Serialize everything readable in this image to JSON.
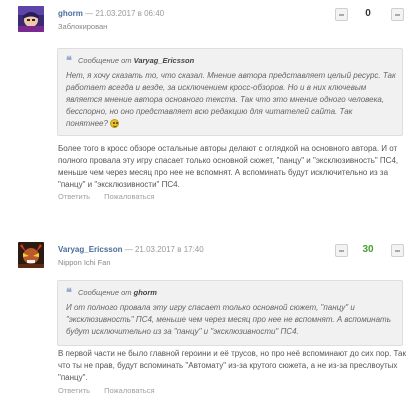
{
  "comments": [
    {
      "author": "ghorm",
      "dash": "—",
      "date": "21.03.2017 в 06:40",
      "subtitle": "Заблокирован",
      "score": "0",
      "quote": {
        "header_prefix": "Сообщение от",
        "author": "Varyag_Ericsson",
        "body": "Нет, я хочу сказать то, что сказал. Мнение автора представляет целый ресурс. Так работает всегда и везде, за исключением кросс-обзоров. Но и в них ключевым является мнение автора основного текста. Так что это мнение одного человека, бесспорно, но оно представляет всю редакцию для читателей сайта. Так понятнее?"
      },
      "text": "Более того в кросс обзоре остальные авторы делают с оглядкой на основного автора. И от полного провала эту игру спасает только основной сюжет, \"панцу\" и \"эксклюзивность\" ПС4, меньше чем через месяц про нее не вспомнят. А вспоминать будут исключительно из за \"панцу\" и \"эксклюзивности\" ПС4.",
      "reply": "Ответить",
      "report": "Пожаловаться"
    },
    {
      "author": "Varyag_Ericsson",
      "dash": "—",
      "date": "21.03.2017 в 17:40",
      "subtitle": "Nippon Ichi Fan",
      "score": "30",
      "quote": {
        "header_prefix": "Сообщение от",
        "author": "ghorm",
        "body": "И от полного провала эту игру спасает только основной сюжет, \"панцу\" и \"эксклюзивность\" ПС4, меньше чем через месяц про нее не вспомнят. А вспоминать будут исключительно из за \"панцу\" и \"эксклюзивности\" ПС4."
      },
      "text": "В первой части не было главной героини и её трусов, но про неё вспоминают до сих пор. Так что ты не прав, будут вспоминать \"Автомату\" из-за крутого сюжета, а не из-за преслвоутых \"панцу\".",
      "reply": "Ответить",
      "report": "Пожаловаться"
    }
  ],
  "colors": {
    "author": "#4a6c9b",
    "positive_score": "#46a034",
    "quote_bg": "#f1f1f1"
  }
}
